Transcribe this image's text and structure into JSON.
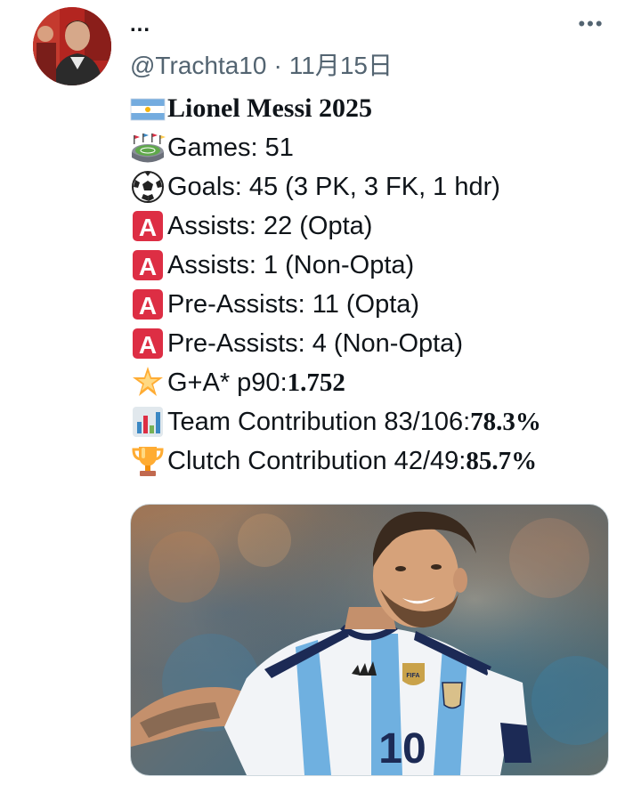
{
  "author": {
    "display_name": "...",
    "handle": "@Trachta10",
    "separator": "·",
    "date": "11月15日"
  },
  "more_icon": "more-horizontal-icon",
  "tweet": {
    "lines": [
      {
        "icon": "argentina-flag-icon",
        "text": "Lionel Messi 2025",
        "bold": ""
      },
      {
        "icon": "stadium-icon",
        "text": "Games: 51",
        "bold": ""
      },
      {
        "icon": "soccer-ball-icon",
        "text": "Goals: 45 (3 PK, 3 FK, 1 hdr)",
        "bold": ""
      },
      {
        "icon": "letter-a-button-icon",
        "text": "Assists: 22 (Opta)",
        "bold": ""
      },
      {
        "icon": "letter-a-button-icon",
        "text": "Assists: 1 (Non-Opta)",
        "bold": ""
      },
      {
        "icon": "letter-a-button-icon",
        "text": "Pre-Assists: 11 (Opta)",
        "bold": ""
      },
      {
        "icon": "letter-a-button-icon",
        "text": "Pre-Assists: 4 (Non-Opta)",
        "bold": ""
      },
      {
        "icon": "glowing-star-icon",
        "text": "G+A* p90: ",
        "bold": "1.752"
      },
      {
        "icon": "bar-chart-icon",
        "text": "Team Contribution 83/106: ",
        "bold": "78.3%"
      },
      {
        "icon": "trophy-icon",
        "text": "Clutch Contribution 42/49: ",
        "bold": "85.7%"
      }
    ]
  },
  "media": {
    "type": "photo",
    "jersey_number": "10"
  },
  "colors": {
    "text": "#0f1419",
    "secondary": "#536471",
    "a_button": "#dd2e44",
    "border": "#cfd9de"
  }
}
